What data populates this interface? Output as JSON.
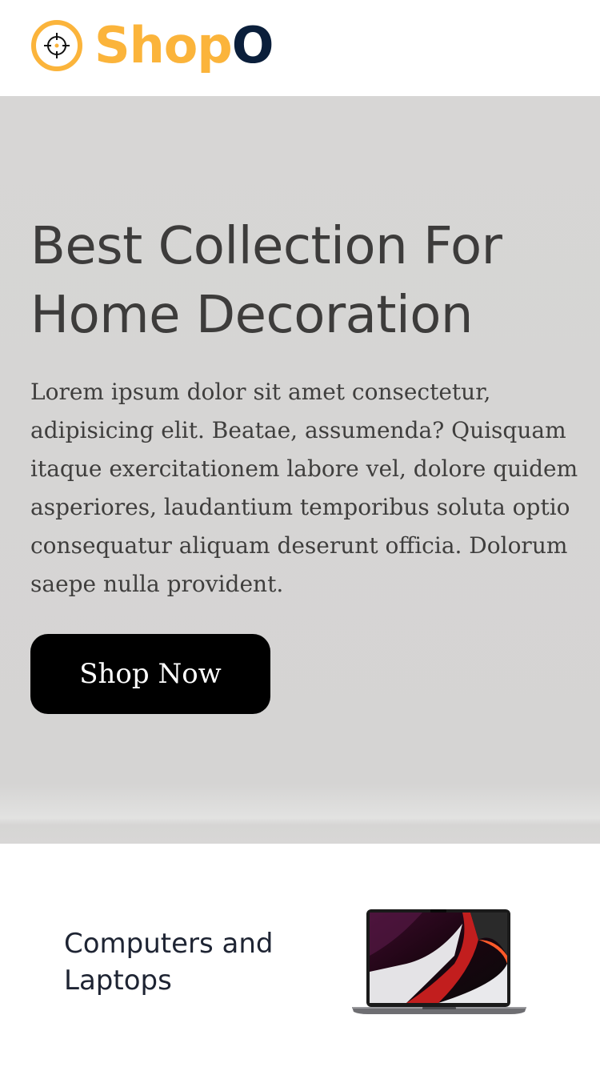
{
  "header": {
    "logo": {
      "part1": "Shop",
      "part2": "O",
      "icon": "crosshair-target-icon"
    }
  },
  "hero": {
    "title": "Best Collection For Home Decoration",
    "text": "Lorem ipsum dolor sit amet consectetur, adipisicing elit. Beatae, assumenda? Quisquam itaque exercitationem labore vel, dolore quidem asperiores, laudantium temporibus soluta optio consequatur aliquam deserunt officia. Dolorum saepe nulla provident.",
    "button_label": "Shop Now"
  },
  "category": {
    "label": "Computers and Laptops",
    "image": "laptop-image"
  },
  "colors": {
    "brand_yellow": "#fbb43b",
    "brand_navy": "#0b1f3b",
    "hero_bg": "#d6d5d4",
    "button_bg": "#000000"
  }
}
